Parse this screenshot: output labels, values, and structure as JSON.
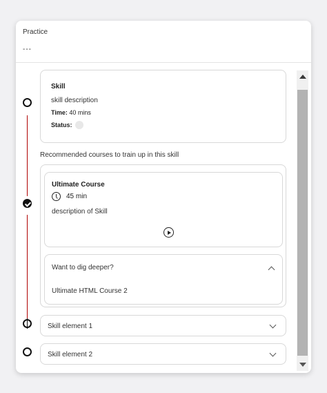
{
  "header": {
    "title": "Practice",
    "subtitle": "---"
  },
  "skill": {
    "title": "Skill",
    "description": "skill description",
    "time_label": "Time:",
    "time_value": "40 mins",
    "status_label": "Status:"
  },
  "recommended": {
    "heading": "Recommended courses to train up in this skill",
    "course": {
      "title": "Ultimate Course",
      "duration": "45 min",
      "description": "description of Skill"
    },
    "dig_deeper": {
      "title": "Want to dig deeper?",
      "items": [
        "Ultimate HTML Course 2"
      ]
    }
  },
  "skill_elements": [
    {
      "label": "Skill element 1"
    },
    {
      "label": "Skill element 2"
    }
  ],
  "colors": {
    "timeline_line": "#b00000",
    "node": "#111111",
    "scroll_thumb": "#b3b3b3"
  }
}
